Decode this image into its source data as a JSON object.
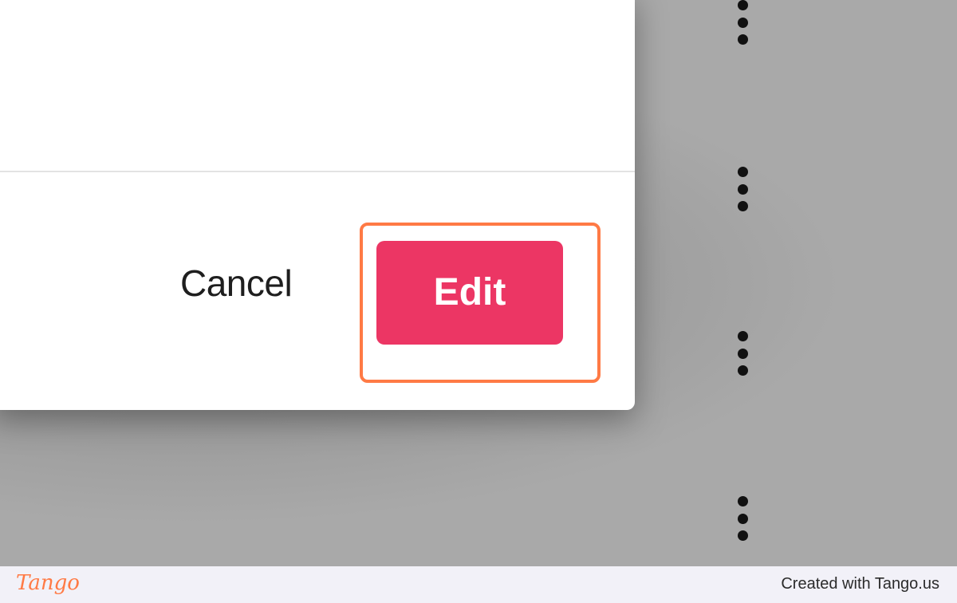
{
  "dialog": {
    "cancel_label": "Cancel",
    "edit_label": "Edit"
  },
  "footer": {
    "logo_text": "Tango",
    "credit_text": "Created with Tango.us"
  },
  "colors": {
    "edit_button": "#ec3664",
    "highlight": "#ff7a45",
    "backdrop": "#a9a9a9"
  },
  "icons": {
    "row_menu": "more-vertical-icon"
  }
}
